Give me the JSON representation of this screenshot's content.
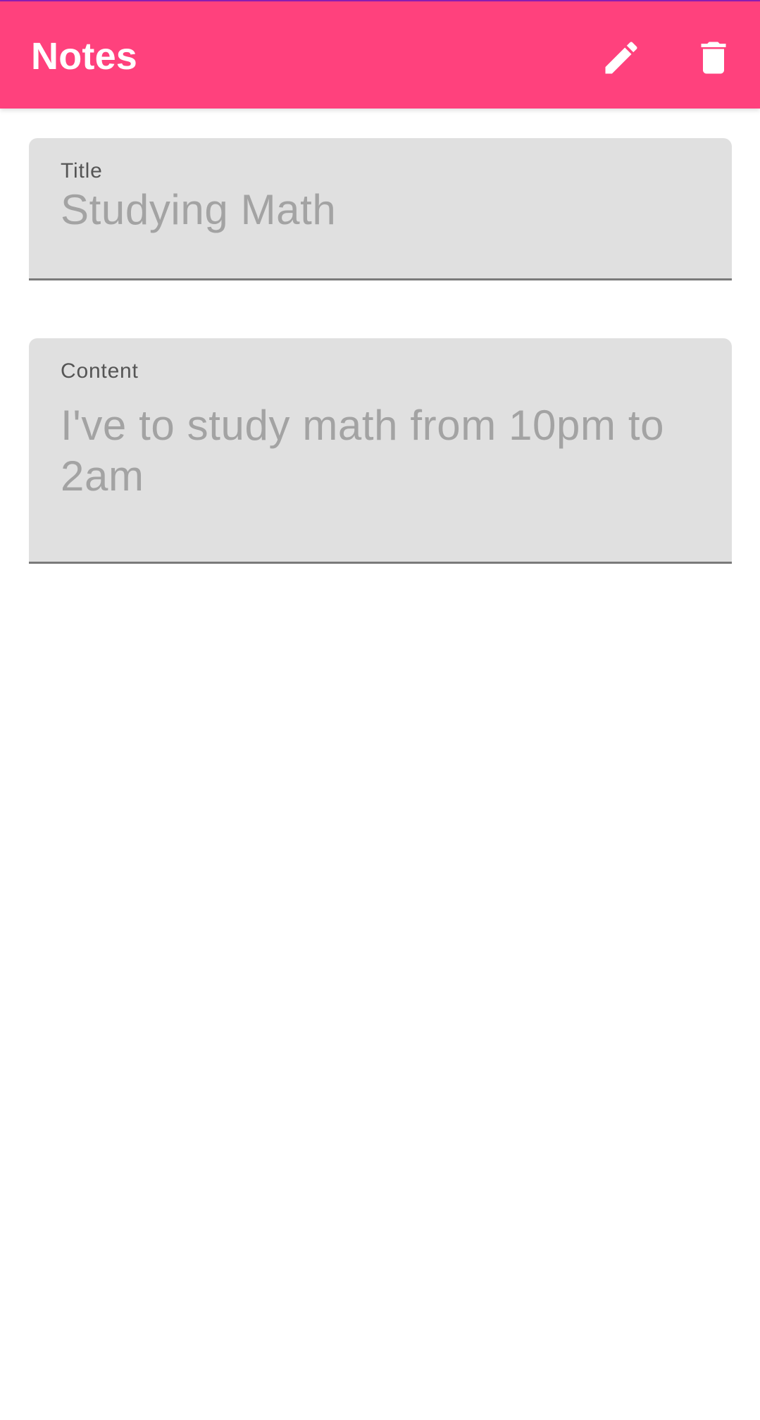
{
  "app_bar": {
    "title": "Notes",
    "background": "#ff417d",
    "actions": [
      {
        "name": "edit",
        "icon": "pencil-icon"
      },
      {
        "name": "delete",
        "icon": "trash-icon"
      }
    ]
  },
  "form": {
    "title_field": {
      "label": "Title",
      "value": "Studying Math"
    },
    "content_field": {
      "label": "Content",
      "value": "I've to study math from 10pm to 2am"
    }
  }
}
